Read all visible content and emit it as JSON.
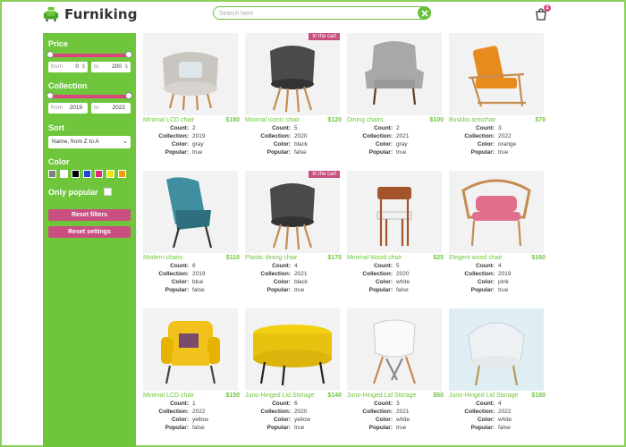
{
  "header": {
    "brand": "Furniking",
    "search_placeholder": "Search here",
    "cart_count": "2"
  },
  "colors": {
    "accent_green": "#6fc63d",
    "accent_pink": "#c94f80"
  },
  "filters": {
    "price_title": "Price",
    "price_from_label": "from",
    "price_from_value": "0",
    "price_to_label": "to",
    "price_to_value": "200",
    "price_unit": "$",
    "collection_title": "Collection",
    "collection_from_label": "from",
    "collection_from_value": "2019",
    "collection_to_label": "to",
    "collection_to_value": "2022",
    "sort_title": "Sort",
    "sort_value": "Name, from Z to A",
    "color_title": "Color",
    "color_swatches": [
      "#808080",
      "#ffffff",
      "#000000",
      "#1e44d8",
      "#e0287a",
      "#f5e600",
      "#f59d00"
    ],
    "popular_label": "Only popular",
    "reset_filters": "Reset filters",
    "reset_settings": "Reset settings"
  },
  "labels": {
    "count": "Count:",
    "collection": "Collection:",
    "color": "Color:",
    "popular": "Popular:"
  },
  "products": [
    {
      "name": "Minimal LCD chair",
      "price": "$180",
      "count": "2",
      "collection": "2019",
      "color": "gray",
      "popular": "true",
      "badge": "",
      "icon": "armchair-gray-icon"
    },
    {
      "name": "Minimal iconic chair",
      "price": "$120",
      "count": "5",
      "collection": "2020",
      "color": "black",
      "popular": "false",
      "badge": "In the cart",
      "icon": "chair-black-icon"
    },
    {
      "name": "Dining chairs",
      "price": "$100",
      "count": "2",
      "collection": "2021",
      "color": "gray",
      "popular": "true",
      "badge": "",
      "icon": "wingchair-gray-icon"
    },
    {
      "name": "Buskbo armchair",
      "price": "$70",
      "count": "3",
      "collection": "2022",
      "color": "orange",
      "popular": "true",
      "badge": "",
      "icon": "armchair-orange-icon"
    },
    {
      "name": "Modern chairs",
      "price": "$110",
      "count": "6",
      "collection": "2019",
      "color": "blue",
      "popular": "false",
      "badge": "",
      "icon": "lounge-blue-icon"
    },
    {
      "name": "Plastic dining chair",
      "price": "$170",
      "count": "4",
      "collection": "2021",
      "color": "black",
      "popular": "true",
      "badge": "In the cart",
      "icon": "chair-black-icon"
    },
    {
      "name": "Minimal Wood chair",
      "price": "$25",
      "count": "5",
      "collection": "2020",
      "color": "white",
      "popular": "false",
      "badge": "",
      "icon": "wood-chair-icon"
    },
    {
      "name": "Elegent wood chair",
      "price": "$160",
      "count": "4",
      "collection": "2019",
      "color": "pink",
      "popular": "true",
      "badge": "",
      "icon": "rattan-pink-icon"
    },
    {
      "name": "Minimal LCD chair",
      "price": "$150",
      "count": "1",
      "collection": "2022",
      "color": "yellow",
      "popular": "false",
      "badge": "",
      "icon": "armchair-yellow-icon"
    },
    {
      "name": "Juno-Hinged Lid Storage",
      "price": "$140",
      "count": "6",
      "collection": "2020",
      "color": "yellow",
      "popular": "true",
      "badge": "",
      "icon": "ottoman-yellow-icon"
    },
    {
      "name": "Juno-Hinged Lid Storage",
      "price": "$50",
      "count": "3",
      "collection": "2021",
      "color": "white",
      "popular": "true",
      "badge": "",
      "icon": "chair-white-icon"
    },
    {
      "name": "Juno-Hinged Lid Storage",
      "price": "$180",
      "count": "4",
      "collection": "2022",
      "color": "white",
      "popular": "false",
      "badge": "",
      "icon": "shell-white-icon"
    }
  ]
}
